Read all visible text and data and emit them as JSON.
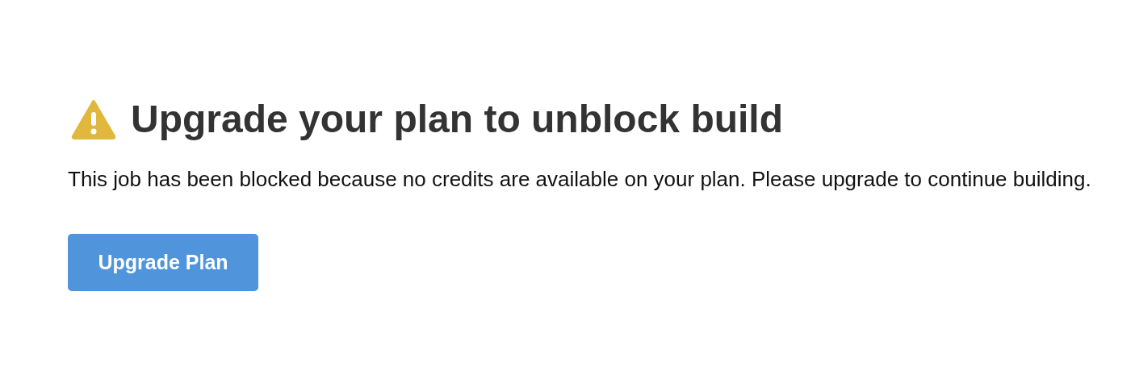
{
  "heading": "Upgrade your plan to unblock build",
  "message": "This job has been blocked because no credits are available on your plan. Please upgrade to continue building.",
  "button": "Upgrade Plan"
}
